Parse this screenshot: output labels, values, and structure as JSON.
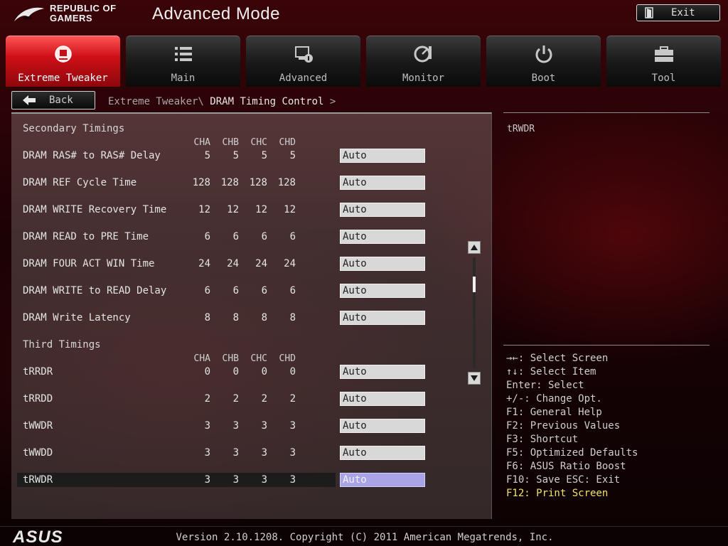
{
  "header": {
    "brand_line1": "REPUBLIC OF",
    "brand_line2": "GAMERS",
    "mode_title": "Advanced Mode",
    "exit_label": "Exit"
  },
  "tabs": [
    {
      "label": "Extreme Tweaker",
      "icon": "extreme-tweaker-icon",
      "active": true
    },
    {
      "label": "Main",
      "icon": "list-icon",
      "active": false
    },
    {
      "label": "Advanced",
      "icon": "advanced-settings-icon",
      "active": false
    },
    {
      "label": "Monitor",
      "icon": "monitor-gauge-icon",
      "active": false
    },
    {
      "label": "Boot",
      "icon": "power-icon",
      "active": false
    },
    {
      "label": "Tool",
      "icon": "toolbox-icon",
      "active": false
    }
  ],
  "nav": {
    "back_label": "Back",
    "breadcrumb_parent": "Extreme Tweaker\\",
    "breadcrumb_current": "DRAM Timing Control",
    "breadcrumb_arrow": ">"
  },
  "columns": [
    "CHA",
    "CHB",
    "CHC",
    "CHD"
  ],
  "secondary": {
    "title": "Secondary Timings",
    "rows": [
      {
        "label": "DRAM RAS# to RAS# Delay",
        "values": [
          "5",
          "5",
          "5",
          "5"
        ],
        "option": "Auto"
      },
      {
        "label": "DRAM REF Cycle Time",
        "values": [
          "128",
          "128",
          "128",
          "128"
        ],
        "option": "Auto"
      },
      {
        "label": "DRAM WRITE Recovery Time",
        "values": [
          "12",
          "12",
          "12",
          "12"
        ],
        "option": "Auto"
      },
      {
        "label": "DRAM READ to PRE Time",
        "values": [
          "6",
          "6",
          "6",
          "6"
        ],
        "option": "Auto"
      },
      {
        "label": "DRAM FOUR ACT WIN Time",
        "values": [
          "24",
          "24",
          "24",
          "24"
        ],
        "option": "Auto"
      },
      {
        "label": "DRAM WRITE to READ Delay",
        "values": [
          "6",
          "6",
          "6",
          "6"
        ],
        "option": "Auto"
      },
      {
        "label": "DRAM Write Latency",
        "values": [
          "8",
          "8",
          "8",
          "8"
        ],
        "option": "Auto"
      }
    ]
  },
  "third": {
    "title": "Third Timings",
    "rows": [
      {
        "label": "tRRDR",
        "values": [
          "0",
          "0",
          "0",
          "0"
        ],
        "option": "Auto"
      },
      {
        "label": "tRRDD",
        "values": [
          "2",
          "2",
          "2",
          "2"
        ],
        "option": "Auto"
      },
      {
        "label": "tWWDR",
        "values": [
          "3",
          "3",
          "3",
          "3"
        ],
        "option": "Auto"
      },
      {
        "label": "tWWDD",
        "values": [
          "3",
          "3",
          "3",
          "3"
        ],
        "option": "Auto"
      },
      {
        "label": "tRWDR",
        "values": [
          "3",
          "3",
          "3",
          "3"
        ],
        "option": "Auto",
        "selected": true
      }
    ]
  },
  "help": {
    "title": "tRWDR",
    "shortcuts": [
      {
        "text": "→←: Select Screen",
        "highlight": false
      },
      {
        "text": "↑↓: Select Item",
        "highlight": false
      },
      {
        "text": "Enter: Select",
        "highlight": false
      },
      {
        "text": "+/-: Change Opt.",
        "highlight": false
      },
      {
        "text": "F1: General Help",
        "highlight": false
      },
      {
        "text": "F2: Previous Values",
        "highlight": false
      },
      {
        "text": "F3: Shortcut",
        "highlight": false
      },
      {
        "text": "F5: Optimized Defaults",
        "highlight": false
      },
      {
        "text": "F6: ASUS Ratio Boost",
        "highlight": false
      },
      {
        "text": "F10: Save  ESC: Exit",
        "highlight": false
      },
      {
        "text": "F12: Print Screen",
        "highlight": true
      }
    ]
  },
  "footer": {
    "brand": "ASUS",
    "version": "Version 2.10.1208. Copyright (C) 2011 American Megatrends, Inc."
  },
  "colors": {
    "active_tab": "#d01018",
    "selected_option": "#a8a4e6",
    "highlight_shortcut": "#f2e46a"
  }
}
